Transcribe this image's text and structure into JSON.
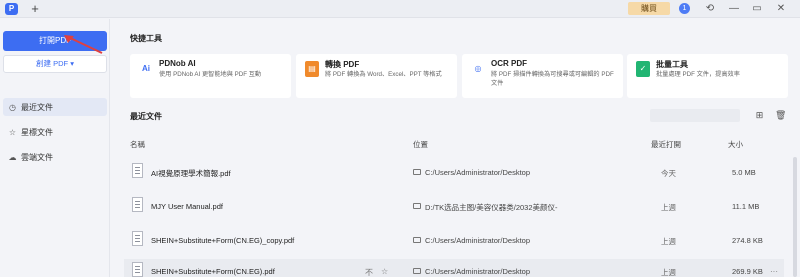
{
  "titlebar": {
    "logo": "P",
    "new_tab": "+",
    "buy_label": "購買",
    "badge_count": "1",
    "icons": [
      "refresh-icon",
      "minimize-icon",
      "maximize-icon",
      "close-icon"
    ]
  },
  "sidebar": {
    "open_label": "打開PDF",
    "create_label": "創建 PDF ▾",
    "items": [
      {
        "label": "最近文件",
        "icon": "clock-icon",
        "active": true
      },
      {
        "label": "星標文件",
        "icon": "star-icon",
        "active": false
      },
      {
        "label": "雲端文件",
        "icon": "cloud-icon",
        "active": false
      }
    ]
  },
  "quick_tools": {
    "title": "快捷工具",
    "cards": [
      {
        "title": "PDNob AI",
        "desc": "使用 PDNob AI 更智能地與 PDF 互動",
        "icon": "ai-icon",
        "icon_text": "Ai",
        "color": "#ffffff",
        "text_color": "#3d6df2"
      },
      {
        "title": "轉換 PDF",
        "desc": "將 PDF 轉換為 Word、Excel、PPT 等格式",
        "icon": "convert-icon",
        "icon_text": "▤",
        "color": "#f08a2c",
        "text_color": "#ffffff"
      },
      {
        "title": "OCR PDF",
        "desc": "將 PDF 掃描件轉換為可搜尋或可編輯的 PDF 文件",
        "icon": "ocr-icon",
        "icon_text": "◎",
        "color": "#ffffff",
        "text_color": "#3d6df2"
      },
      {
        "title": "批量工具",
        "desc": "批量處理 PDF 文件，提高效率",
        "icon": "batch-icon",
        "icon_text": "✓",
        "color": "#22b573",
        "text_color": "#ffffff"
      }
    ]
  },
  "recent": {
    "title": "最近文件",
    "columns": {
      "name": "名稱",
      "location": "位置",
      "last_opened": "最近打開",
      "size": "大小"
    },
    "files": [
      {
        "name": "AI視覺原理學术簡報.pdf",
        "path": "C:/Users/Administrator/Desktop",
        "time": "今天",
        "size": "5.0 MB"
      },
      {
        "name": "MJY User Manual.pdf",
        "path": "D:/TK选品主图/美容仪器类/2032美颜仪-",
        "time": "上週",
        "size": "11.1 MB"
      },
      {
        "name": "SHEIN+Substitute+Form(CN.EG)_copy.pdf",
        "path": "C:/Users/Administrator/Desktop",
        "time": "上週",
        "size": "274.8 KB"
      },
      {
        "name": "SHEIN+Substitute+Form(CN.EG).pdf",
        "path": "C:/Users/Administrator/Desktop",
        "time": "上週",
        "size": "269.9 KB"
      }
    ],
    "row_actions": {
      "pin": "不",
      "star": "☆",
      "more": "···"
    }
  }
}
